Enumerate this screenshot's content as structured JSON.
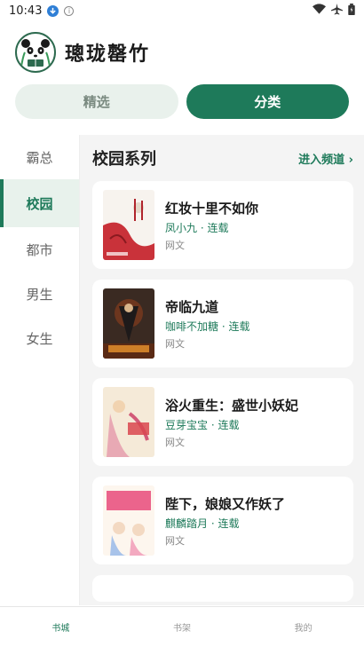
{
  "status_bar": {
    "time": "10:43",
    "info_glyph": "i"
  },
  "header": {
    "title": "璁珑罄竹"
  },
  "top_tabs": [
    {
      "label": "精选",
      "active": false
    },
    {
      "label": "分类",
      "active": true
    }
  ],
  "sidebar": {
    "items": [
      {
        "label": "霸总",
        "active": false
      },
      {
        "label": "校园",
        "active": true
      },
      {
        "label": "都市",
        "active": false
      },
      {
        "label": "男生",
        "active": false
      },
      {
        "label": "女生",
        "active": false
      }
    ]
  },
  "section": {
    "title": "校园系列",
    "more": "进入频道 ›"
  },
  "books": [
    {
      "title": "红妆十里不如你",
      "meta": "凤小九 · 连载",
      "tag": "网文"
    },
    {
      "title": "帝临九道",
      "meta": "咖啡不加糖 · 连载",
      "tag": "网文"
    },
    {
      "title": "浴火重生：盛世小妖妃",
      "meta": "豆芽宝宝 · 连载",
      "tag": "网文"
    },
    {
      "title": "陛下，娘娘又作妖了",
      "meta": "麒麟踏月 · 连载",
      "tag": "网文"
    }
  ],
  "bottom_nav": [
    {
      "label": "书城",
      "active": true
    },
    {
      "label": "书架",
      "active": false
    },
    {
      "label": "我的",
      "active": false
    }
  ],
  "colors": {
    "accent": "#1e7a5a",
    "accent_light": "#e8f2ec",
    "background": "#f4f4f4"
  }
}
